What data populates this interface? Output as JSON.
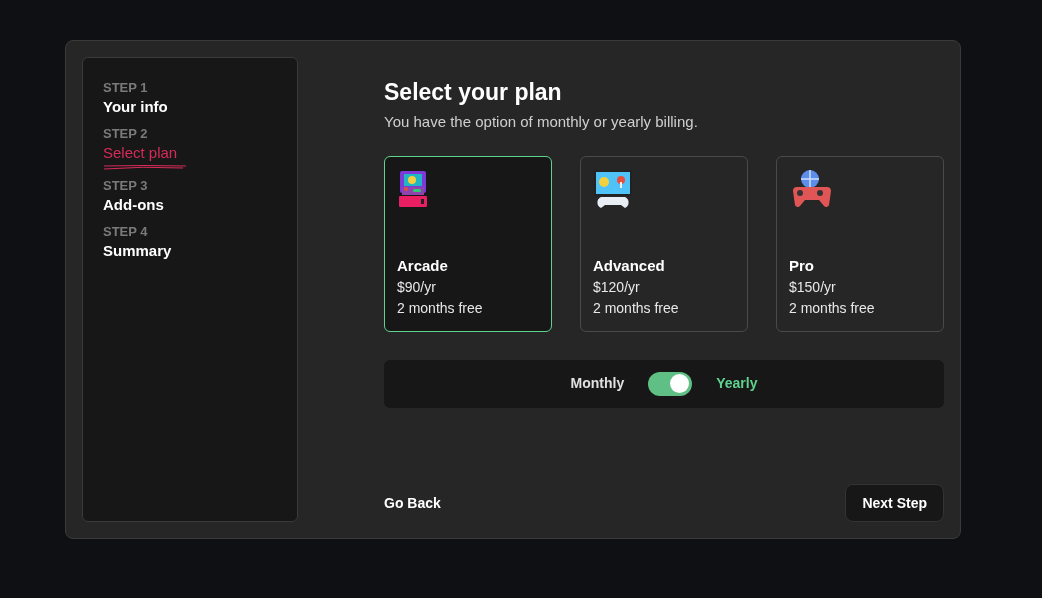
{
  "steps": [
    {
      "label": "STEP 1",
      "title": "Your info",
      "selected": false
    },
    {
      "label": "STEP 2",
      "title": "Select plan",
      "selected": true
    },
    {
      "label": "STEP 3",
      "title": "Add-ons",
      "selected": false
    },
    {
      "label": "STEP 4",
      "title": "Summary",
      "selected": false
    }
  ],
  "heading": "Select your plan",
  "subtitle": "You have the option of monthly or yearly billing.",
  "plans": [
    {
      "kind": "arcade",
      "name": "Arcade",
      "price": "$90/yr",
      "note": "2 months free",
      "selected": true
    },
    {
      "kind": "advanced",
      "name": "Advanced",
      "price": "$120/yr",
      "note": "2 months free",
      "selected": false
    },
    {
      "kind": "pro",
      "name": "Pro",
      "price": "$150/yr",
      "note": "2 months free",
      "selected": false
    }
  ],
  "billing": {
    "monthly_label": "Monthly",
    "yearly_label": "Yearly",
    "yearly": true
  },
  "back_button": "Go Back",
  "next_button": "Next Step"
}
